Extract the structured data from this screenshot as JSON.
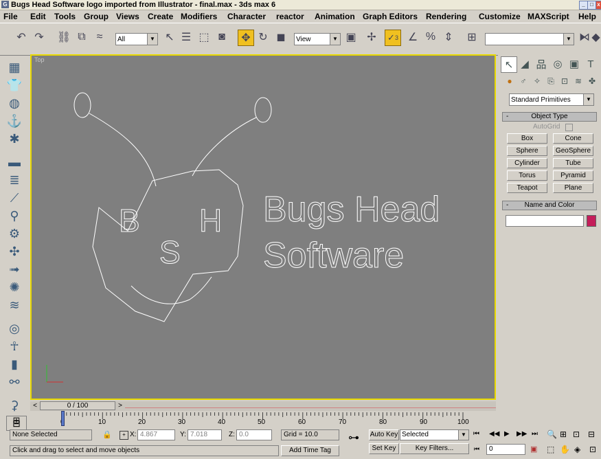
{
  "window": {
    "title": "Bugs Head Software logo imported from Illustrator - final.max - 3ds max 6"
  },
  "menus": [
    "File",
    "Edit",
    "Tools",
    "Group",
    "Views",
    "Create",
    "Modifiers",
    "Character",
    "reactor",
    "Animation",
    "Graph Editors",
    "Rendering",
    "Customize",
    "MAXScript",
    "Help"
  ],
  "toolbar": {
    "selection_filter": "All",
    "reference_coord": "View",
    "snap_badge": "3",
    "named_selection": ""
  },
  "viewport": {
    "label": "Top",
    "logo": {
      "letters": [
        "B",
        "S",
        "H"
      ],
      "line1": "Bugs Head",
      "line2": "Software"
    }
  },
  "command_panel": {
    "dropdown": "Standard Primitives",
    "object_type": {
      "header": "Object Type",
      "autogrid": "AutoGrid",
      "buttons": [
        "Box",
        "Cone",
        "Sphere",
        "GeoSphere",
        "Cylinder",
        "Tube",
        "Torus",
        "Pyramid",
        "Teapot",
        "Plane"
      ]
    },
    "name_color": {
      "header": "Name and Color",
      "name_value": "",
      "swatch_color": "#c41e5a"
    }
  },
  "timeline": {
    "frame_display": "0 / 100",
    "ticks": [
      "0",
      "10",
      "20",
      "30",
      "40",
      "50",
      "60",
      "70",
      "80",
      "90",
      "100"
    ]
  },
  "status": {
    "selection": "None Selected",
    "x_label": "X:",
    "x": "4.867",
    "y_label": "Y:",
    "y": "7.018",
    "z_label": "Z:",
    "z": "0.0",
    "grid": "Grid = 10.0",
    "auto_key": "Auto Key",
    "key_mode": "Selected",
    "set_key": "Set Key",
    "key_filters": "Key Filters...",
    "current_frame": "0",
    "prompt": "Click and drag to select and move objects",
    "add_time_tag": "Add Time Tag"
  }
}
